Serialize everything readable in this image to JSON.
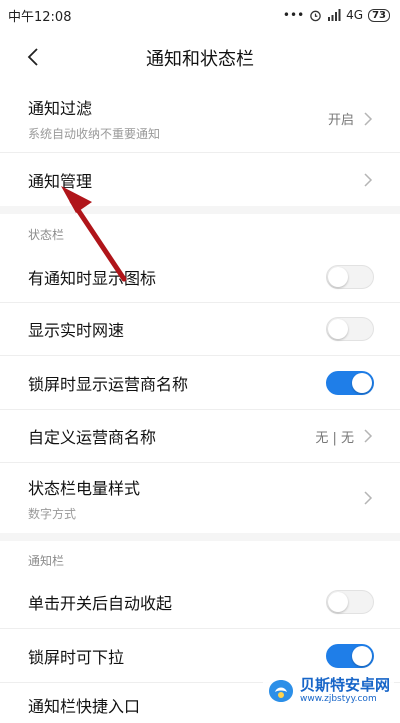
{
  "status_bar": {
    "time": "中午12:08",
    "dots": "•••",
    "network": "4G",
    "battery": "73"
  },
  "header": {
    "title": "通知和状态栏"
  },
  "rows_top": [
    {
      "label": "通知过滤",
      "sub": "系统自动收纳不重要通知",
      "value": "开启"
    },
    {
      "label": "通知管理"
    }
  ],
  "section_status": "状态栏",
  "rows_status": [
    {
      "label": "有通知时显示图标",
      "toggle": false
    },
    {
      "label": "显示实时网速",
      "toggle": false
    },
    {
      "label": "锁屏时显示运营商名称",
      "toggle": true
    },
    {
      "label": "自定义运营商名称",
      "value": "无 | 无"
    },
    {
      "label": "状态栏电量样式",
      "sub": "数字方式"
    }
  ],
  "section_notify": "通知栏",
  "rows_notify": [
    {
      "label": "单击开关后自动收起",
      "toggle": false
    },
    {
      "label": "锁屏时可下拉",
      "toggle": true
    },
    {
      "label": "通知栏快捷入口"
    }
  ],
  "watermark": {
    "title": "贝斯特安卓网",
    "url": "www.zjbstyy.com"
  },
  "colors": {
    "accent": "#1f7ee8",
    "arrow": "#b0151a"
  }
}
